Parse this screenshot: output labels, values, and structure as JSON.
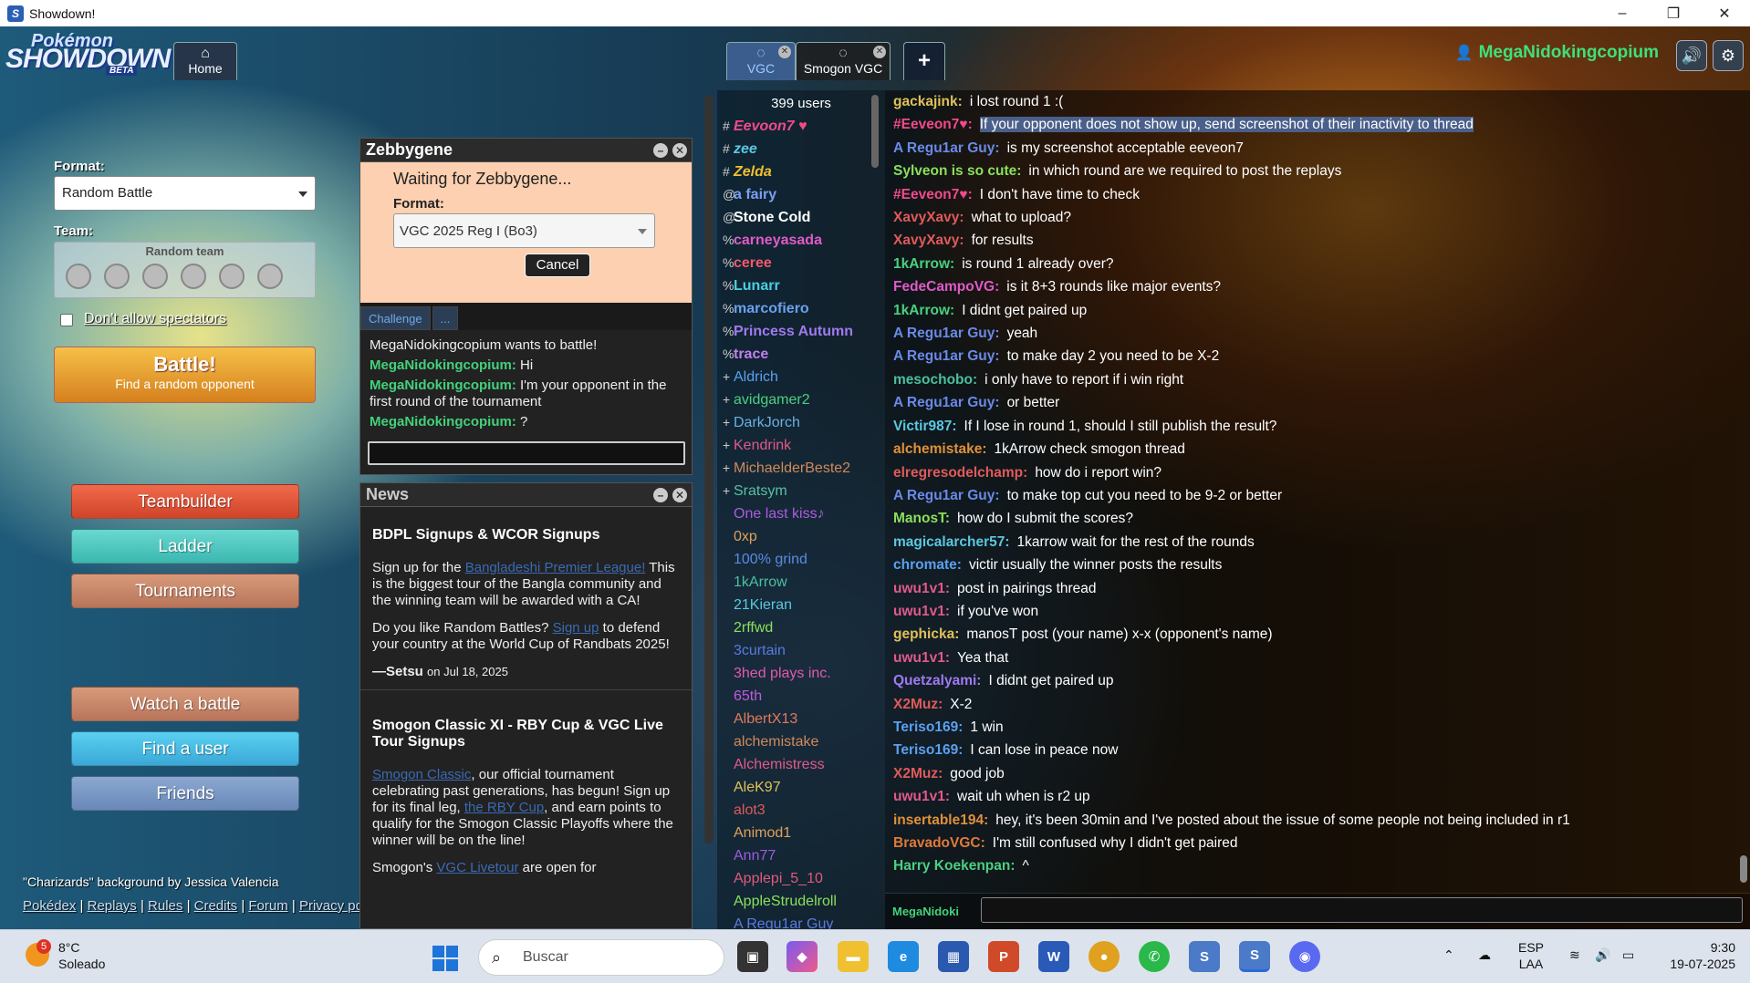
{
  "window": {
    "title": "Showdown!",
    "controls": [
      "–",
      "❐",
      "✕"
    ]
  },
  "header": {
    "logo": {
      "line1": "Pokémon",
      "line2": "SHOWDOWN",
      "line3": "BETA"
    },
    "tabs": [
      {
        "label": "Home",
        "icon": "⌂"
      },
      {
        "label": "VGC",
        "icon": "💬"
      },
      {
        "label": "Smogon VGC",
        "icon": "💬"
      },
      {
        "label": "+"
      }
    ],
    "username": "MegaNidokingcopium",
    "sound_icon": "🔊",
    "settings_icon": "⚙"
  },
  "left": {
    "format_label": "Format:",
    "format_value": "Random Battle",
    "team_label": "Team:",
    "team_value": "Random team",
    "spectators_label": "Don't allow spectators",
    "battle_title": "Battle!",
    "battle_sub": "Find a random opponent",
    "buttons": [
      "Teambuilder",
      "Ladder",
      "Tournaments",
      "Watch a battle",
      "Find a user",
      "Friends"
    ],
    "credit": "\"Charizards\" background by Jessica Valencia",
    "links": [
      "Pokédex",
      "Replays",
      "Rules",
      "Credits",
      "Forum",
      "Privacy policy"
    ]
  },
  "challenge": {
    "title": "Zebbygene",
    "waiting": "Waiting for Zebbygene...",
    "format_label": "Format:",
    "format_value": "VGC 2025 Reg I (Bo3)",
    "cancel": "Cancel",
    "tabs": [
      "Challenge",
      "..."
    ],
    "intro": "MegaNidokingcopium wants to battle!",
    "messages": [
      {
        "user": "MegaNidokingcopium:",
        "text": "Hi"
      },
      {
        "user": "MegaNidokingcopium:",
        "text": "I'm your opponent in the first round of the tournament"
      },
      {
        "user": "MegaNidokingcopium:",
        "text": "?"
      }
    ]
  },
  "news": {
    "title": "News",
    "item1": {
      "heading": "BDPL Signups & WCOR Signups",
      "p1_pre": "Sign up for the ",
      "p1_link": "Bangladeshi Premier League!",
      "p1_post": " This is the biggest tour of the Bangla community and the winning team will be awarded with a CA!",
      "p2_pre": "Do you like Random Battles? ",
      "p2_link": "Sign up",
      "p2_post": " to defend your country at the World Cup of Randbats 2025!",
      "author": "—Setsu",
      "date": "on Jul 18, 2025"
    },
    "item2": {
      "heading": "Smogon Classic XI - RBY Cup & VGC Live Tour Signups",
      "p1_link": "Smogon Classic",
      "p1_mid": ", our official tournament celebrating past generations, has begun! Sign up for its final leg, ",
      "p1_link2": "the RBY Cup",
      "p1_post": ", and earn points to qualify for the Smogon Classic Playoffs where the winner will be on the line!",
      "p2_pre": "Smogon's ",
      "p2_link": "VGC Livetour",
      "p2_post": " are open for"
    }
  },
  "users": {
    "count": "399 users",
    "list": [
      {
        "rank": "#",
        "name": "Eevoon7 ♥",
        "color": "#f04a8a",
        "style": "bi"
      },
      {
        "rank": "#",
        "name": "zee",
        "color": "#5ac8e0",
        "style": "bi"
      },
      {
        "rank": "#",
        "name": "Zelda",
        "color": "#f0c030",
        "style": "bi"
      },
      {
        "rank": "@",
        "name": "a fairy",
        "color": "#7aa0f0",
        "style": "b"
      },
      {
        "rank": "@",
        "name": "Stone Cold",
        "color": "#ffffff",
        "style": "b"
      },
      {
        "rank": "%",
        "name": "carneyasada",
        "color": "#e05ac8",
        "style": "b"
      },
      {
        "rank": "%",
        "name": "ceree",
        "color": "#f05a6a",
        "style": "b"
      },
      {
        "rank": "%",
        "name": "Lunarr",
        "color": "#4ad0e0",
        "style": "b"
      },
      {
        "rank": "%",
        "name": "marcofiero",
        "color": "#6aa0f0",
        "style": "b"
      },
      {
        "rank": "%",
        "name": "Princess Autumn",
        "color": "#a07af0",
        "style": "b"
      },
      {
        "rank": "%",
        "name": "trace",
        "color": "#c080f0",
        "style": "b"
      },
      {
        "rank": "+",
        "name": "Aldrich",
        "color": "#5aa0f0",
        "style": ""
      },
      {
        "rank": "+",
        "name": "avidgamer2",
        "color": "#4ad080",
        "style": ""
      },
      {
        "rank": "+",
        "name": "DarkJorch",
        "color": "#6ab0e0",
        "style": ""
      },
      {
        "rank": "+",
        "name": "Kendrink",
        "color": "#e05a8a",
        "style": ""
      },
      {
        "rank": "+",
        "name": "MichaelderBeste2",
        "color": "#d08a5a",
        "style": ""
      },
      {
        "rank": "+",
        "name": "Sratsym",
        "color": "#5ac0a0",
        "style": ""
      },
      {
        "rank": "",
        "name": "One last kiss♪",
        "color": "#b05ae0",
        "style": ""
      },
      {
        "rank": "",
        "name": "0xp",
        "color": "#e0a05a",
        "style": ""
      },
      {
        "rank": "",
        "name": "100% grind",
        "color": "#5a8ae0",
        "style": ""
      },
      {
        "rank": "",
        "name": "1kArrow",
        "color": "#4ac0a0",
        "style": ""
      },
      {
        "rank": "",
        "name": "21Kieran",
        "color": "#5ac8e0",
        "style": ""
      },
      {
        "rank": "",
        "name": "2rffwd",
        "color": "#8ae05a",
        "style": ""
      },
      {
        "rank": "",
        "name": "3curtain",
        "color": "#5a7ae0",
        "style": ""
      },
      {
        "rank": "",
        "name": "3hed plays inc.",
        "color": "#e05ab0",
        "style": ""
      },
      {
        "rank": "",
        "name": "65th",
        "color": "#c05ae0",
        "style": ""
      },
      {
        "rank": "",
        "name": "AlbertX13",
        "color": "#e07a5a",
        "style": ""
      },
      {
        "rank": "",
        "name": "alchemistake",
        "color": "#d08a5a",
        "style": ""
      },
      {
        "rank": "",
        "name": "Alchemistress",
        "color": "#e05a8a",
        "style": ""
      },
      {
        "rank": "",
        "name": "AleK97",
        "color": "#e0c05a",
        "style": ""
      },
      {
        "rank": "",
        "name": "alot3",
        "color": "#e05a5a",
        "style": ""
      },
      {
        "rank": "",
        "name": "Animod1",
        "color": "#e0a05a",
        "style": ""
      },
      {
        "rank": "",
        "name": "Ann77",
        "color": "#a05ae0",
        "style": ""
      },
      {
        "rank": "",
        "name": "Applepi_5_10",
        "color": "#e05a7a",
        "style": ""
      },
      {
        "rank": "",
        "name": "AppleStrudelroll",
        "color": "#8ae05a",
        "style": ""
      },
      {
        "rank": "",
        "name": "A Regu1ar Guy",
        "color": "#5a7ae0",
        "style": ""
      }
    ]
  },
  "chat": {
    "lines": [
      {
        "user": "gackajink:",
        "color": "#e0c05a",
        "text": "i lost round 1 :("
      },
      {
        "user": "#Eeveon7♥:",
        "color": "#f04a8a",
        "text": "If your opponent does not show up, send screenshot of their inactivity to thread",
        "hl": true
      },
      {
        "user": "A Regu1ar Guy:",
        "color": "#6a8ae8",
        "text": "is my screenshot acceptable eeveon7"
      },
      {
        "user": "Sylveon is so cute:",
        "color": "#8ae05a",
        "text": "in which round are we required to post the replays"
      },
      {
        "user": "#Eeveon7♥:",
        "color": "#f04a8a",
        "text": "I don't have time to check"
      },
      {
        "user": "XavyXavy:",
        "color": "#e05a5a",
        "text": "what to upload?"
      },
      {
        "user": "XavyXavy:",
        "color": "#e05a5a",
        "text": "for results"
      },
      {
        "user": "1kArrow:",
        "color": "#4ad080",
        "text": "is round 1 already over?"
      },
      {
        "user": "FedeCampoVG:",
        "color": "#e05ac8",
        "text": "is it 8+3 rounds like major events?"
      },
      {
        "user": "1kArrow:",
        "color": "#4ad080",
        "text": "I didnt get paired up"
      },
      {
        "user": "A Regu1ar Guy:",
        "color": "#6a8ae8",
        "text": "yeah"
      },
      {
        "user": "A Regu1ar Guy:",
        "color": "#6a8ae8",
        "text": "to make day 2 you need to be X-2"
      },
      {
        "user": "mesochobo:",
        "color": "#4ac0a0",
        "text": "i only have to report if i win right"
      },
      {
        "user": "A Regu1ar Guy:",
        "color": "#6a8ae8",
        "text": "or better"
      },
      {
        "user": "Victir987:",
        "color": "#5ac8e0",
        "text": "If I lose in round 1, should I still publish the result?"
      },
      {
        "user": "alchemistake:",
        "color": "#e0903a",
        "text": "1kArrow check smogon thread"
      },
      {
        "user": "elregresodelchamp:",
        "color": "#e05a5a",
        "text": "how do i report win?"
      },
      {
        "user": "A Regu1ar Guy:",
        "color": "#6a8ae8",
        "text": "to make top cut you need to be 9-2 or better"
      },
      {
        "user": "ManosT:",
        "color": "#8ae05a",
        "text": "how do I submit the scores?"
      },
      {
        "user": "magicalarcher57:",
        "color": "#5ac8e0",
        "text": "1karrow wait for the rest of the rounds"
      },
      {
        "user": "chromate:",
        "color": "#5aa0f0",
        "text": "victir usually the winner posts the results"
      },
      {
        "user": "uwu1v1:",
        "color": "#e05a8a",
        "text": "post in pairings thread"
      },
      {
        "user": "uwu1v1:",
        "color": "#e05a8a",
        "text": "if you've won"
      },
      {
        "user": "gephicka:",
        "color": "#e0c05a",
        "text": "manosT post (your name) x-x (opponent's name)"
      },
      {
        "user": "uwu1v1:",
        "color": "#e05a8a",
        "text": "Yea that"
      },
      {
        "user": "Quetzalyami:",
        "color": "#a07af0",
        "text": "I didnt get paired up"
      },
      {
        "user": "X2Muz:",
        "color": "#e05a5a",
        "text": "X-2"
      },
      {
        "user": "Teriso169:",
        "color": "#5aa0f0",
        "text": "1 win"
      },
      {
        "user": "Teriso169:",
        "color": "#5aa0f0",
        "text": "I can lose in peace now"
      },
      {
        "user": "X2Muz:",
        "color": "#e05a5a",
        "text": "good job"
      },
      {
        "user": "uwu1v1:",
        "color": "#e05a8a",
        "text": "wait uh when is r2 up"
      },
      {
        "user": "insertable194:",
        "color": "#e0903a",
        "text": "hey, it's been 30min and I've posted about the issue of some people not being included in r1"
      },
      {
        "user": "BravadoVGC:",
        "color": "#e07a3a",
        "text": "I'm still confused why I didn't get paired"
      },
      {
        "user": "Harry Koekenpan:",
        "color": "#4ad080",
        "text": "^"
      }
    ],
    "me": "MegaNidoki"
  },
  "taskbar": {
    "temp": "8°C",
    "weather": "Soleado",
    "weather_badge": "5",
    "search": "Buscar",
    "lang1": "ESP",
    "lang2": "LAA",
    "time": "9:30",
    "date": "19-07-2025"
  }
}
